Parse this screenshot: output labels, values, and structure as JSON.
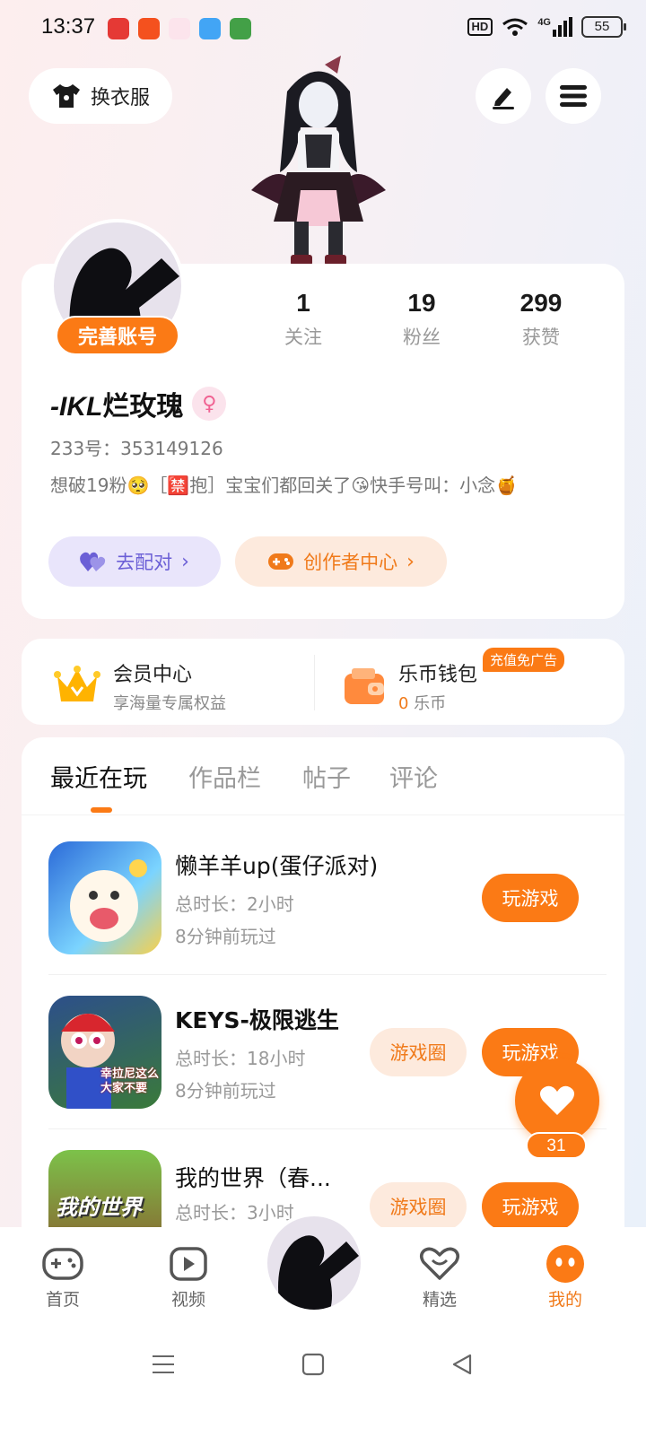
{
  "status_bar": {
    "time": "13:37",
    "network": "4G",
    "battery": "55"
  },
  "top_bar": {
    "outfit_label": "换衣服"
  },
  "profile": {
    "complete_badge": "完善账号",
    "stats": [
      {
        "value": "1",
        "label": "关注"
      },
      {
        "value": "19",
        "label": "粉丝"
      },
      {
        "value": "299",
        "label": "获赞"
      }
    ],
    "username_prefix": "-IKL",
    "username_suffix": "烂玫瑰",
    "gender_symbol": "♀",
    "uid": "233号：353149126",
    "bio": "想破19粉🥺［🈲抱］宝宝们都回关了😘快手号叫：小念🍯",
    "match_label": "去配对",
    "creator_label": "创作者中心"
  },
  "vip": {
    "member_title": "会员中心",
    "member_sub": "享海量专属权益",
    "wallet_title": "乐币钱包",
    "wallet_amount": "0",
    "wallet_unit": " 乐币",
    "ad_badge": "充值免广告"
  },
  "tabs": [
    "最近在玩",
    "作品栏",
    "帖子",
    "评论"
  ],
  "games": [
    {
      "title": "懒羊羊up(蛋仔派对)",
      "duration": "总时长：2小时",
      "last_played": "8分钟前玩过",
      "play_label": "玩游戏"
    },
    {
      "title": "KEYS-极限逃生",
      "duration": "总时长：18小时",
      "last_played": "8分钟前玩过",
      "circle_label": "游戏圈",
      "play_label": "玩游戏",
      "icon_text": "幸拉尼这么\n大家不要"
    },
    {
      "title": "我的世界（春...",
      "duration": "总时长：3小时",
      "circle_label": "游戏圈",
      "play_label": "玩游戏",
      "icon_text": "我的世界"
    }
  ],
  "like_float": {
    "count": "31"
  },
  "bottom_nav": [
    {
      "label": "首页"
    },
    {
      "label": "视频"
    },
    {
      "label": "精选"
    },
    {
      "label": "我的"
    }
  ]
}
